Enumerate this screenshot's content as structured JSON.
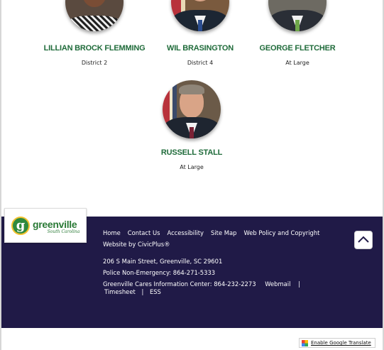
{
  "members": [
    {
      "name": "LILLIAN BROCK FLEMMING",
      "district": "District 2"
    },
    {
      "name": "WIL BRASINGTON",
      "district": "District 4"
    },
    {
      "name": "GEORGE FLETCHER",
      "district": "At Large"
    },
    {
      "name": "RUSSELL STALL",
      "district": "At Large"
    }
  ],
  "footer": {
    "logo": {
      "main": "greenville",
      "sub": "South Carolina"
    },
    "links": [
      "Home",
      "Contact Us",
      "Accessibility",
      "Site Map",
      "Web Policy and Copyright"
    ],
    "credit": "Website by CivicPlus®",
    "address": "206 S Main Street, Greenville, SC 29601",
    "police": "Police Non-Emergency: 864-271-5333",
    "cares": "Greenville Cares Information Center: 864-232-2273",
    "webmail": "Webmail",
    "sep": "|",
    "timesheet": "Timesheet",
    "ess": "ESS"
  },
  "translate_label": "Enable Google Translate",
  "colors": {
    "name_green": "#1f6b3a",
    "footer_bg": "#201a47"
  }
}
